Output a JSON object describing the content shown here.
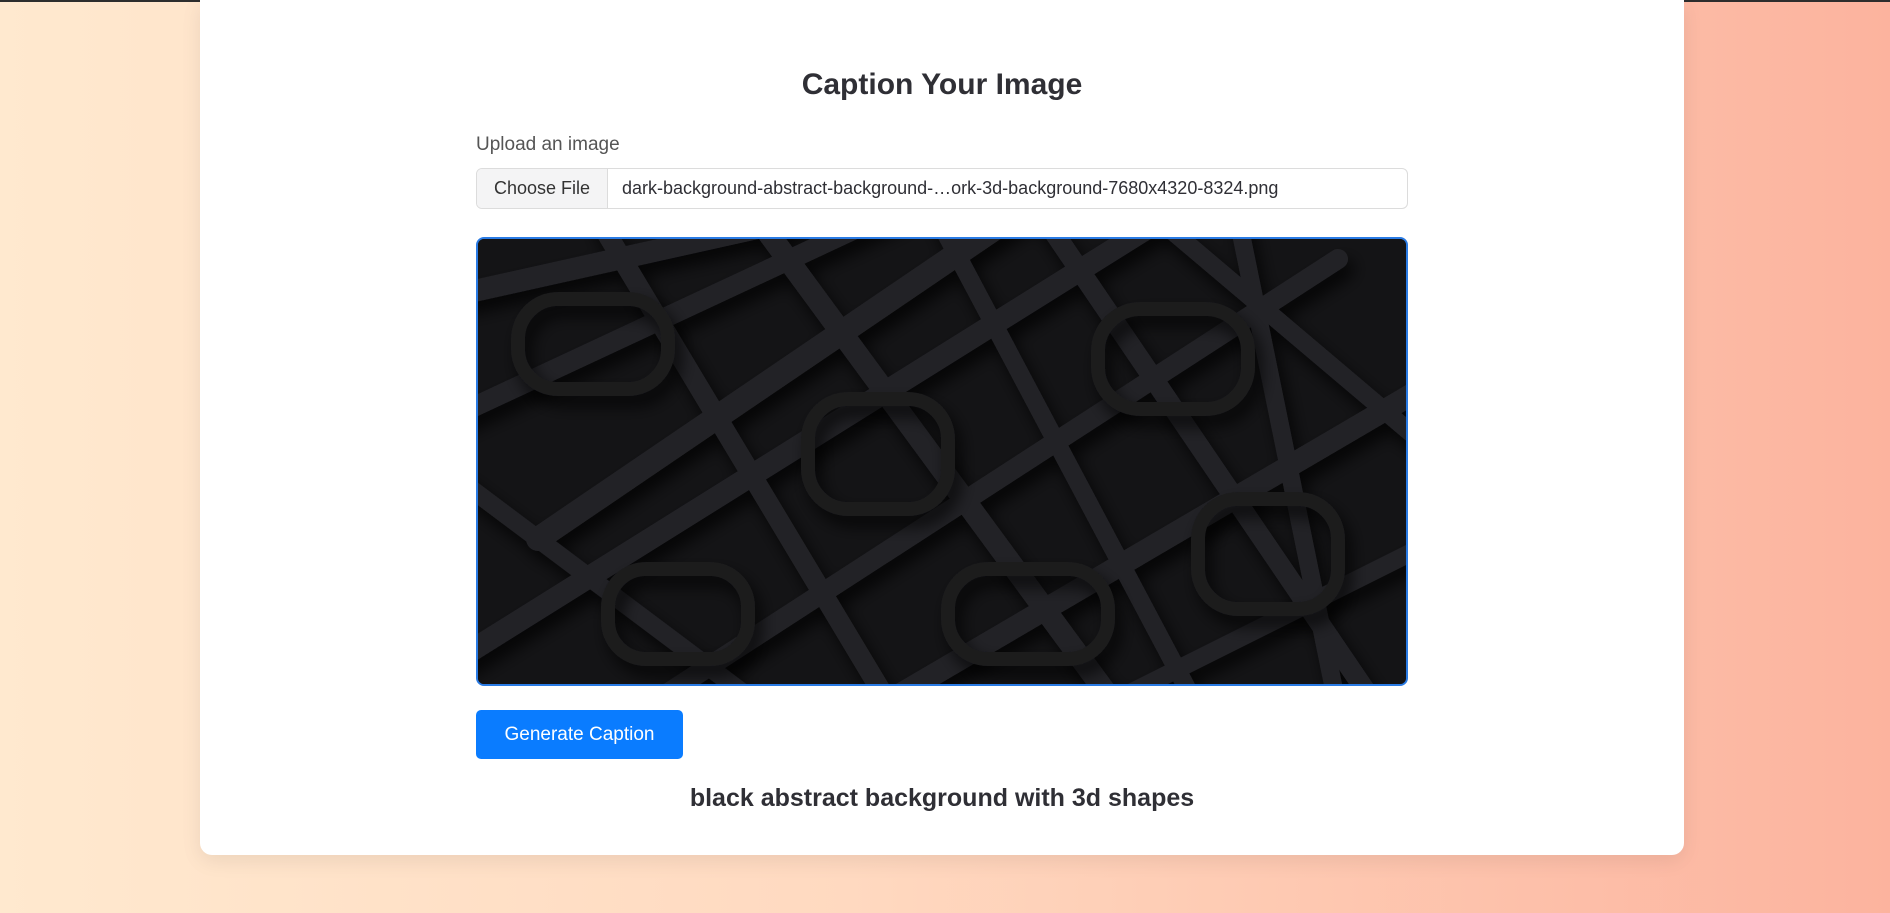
{
  "page": {
    "title": "Caption Your Image"
  },
  "upload": {
    "label": "Upload an image",
    "choose_button": "Choose File",
    "file_name": "dark-background-abstract-background-…ork-3d-background-7680x4320-8324.png"
  },
  "preview": {
    "alt": "uploaded image preview"
  },
  "actions": {
    "generate_label": "Generate Caption"
  },
  "result": {
    "caption": "black abstract background with 3d shapes"
  },
  "colors": {
    "accent": "#0a7cff",
    "preview_border": "#2a7be4",
    "text": "#2f2f35"
  }
}
